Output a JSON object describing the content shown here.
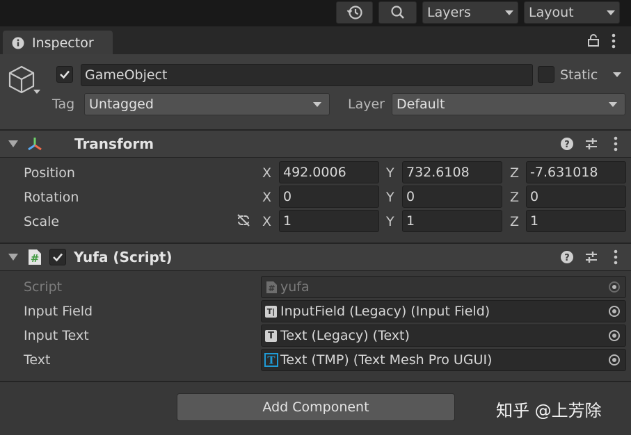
{
  "toolbar": {
    "history_icon": "history-icon",
    "search_icon": "search-icon",
    "layers_label": "Layers",
    "layout_label": "Layout"
  },
  "tab": {
    "label": "Inspector",
    "info_icon": "info-icon",
    "lock_icon": "lock-icon",
    "menu_icon": "kebab-menu-icon"
  },
  "gameobject": {
    "name": "GameObject",
    "active": true,
    "static_label": "Static",
    "tag_label": "Tag",
    "tag_value": "Untagged",
    "layer_label": "Layer",
    "layer_value": "Default"
  },
  "transform": {
    "title": "Transform",
    "rows": [
      {
        "label": "Position",
        "x": "492.0006",
        "y": "732.6108",
        "z": "-7.631018"
      },
      {
        "label": "Rotation",
        "x": "0",
        "y": "0",
        "z": "0"
      },
      {
        "label": "Scale",
        "x": "1",
        "y": "1",
        "z": "1"
      }
    ],
    "axis": {
      "x": "X",
      "y": "Y",
      "z": "Z"
    }
  },
  "script": {
    "title": "Yufa (Script)",
    "enabled": true,
    "rows": [
      {
        "label": "Script",
        "value": "yufa"
      },
      {
        "label": "Input Field",
        "value": "InputField (Legacy) (Input Field)"
      },
      {
        "label": "Input Text",
        "value": "Text (Legacy) (Text)"
      },
      {
        "label": "Text",
        "value": "Text (TMP) (Text Mesh Pro UGUI)"
      }
    ]
  },
  "add_component_label": "Add Component",
  "watermark": "知乎 @上芳除",
  "colors": {
    "background": "#383838",
    "toolbar": "#191919",
    "field": "#2a2a2a",
    "dropdown": "#515151",
    "header": "#3e3e3e",
    "tmp_icon": "#1f9bd6"
  }
}
